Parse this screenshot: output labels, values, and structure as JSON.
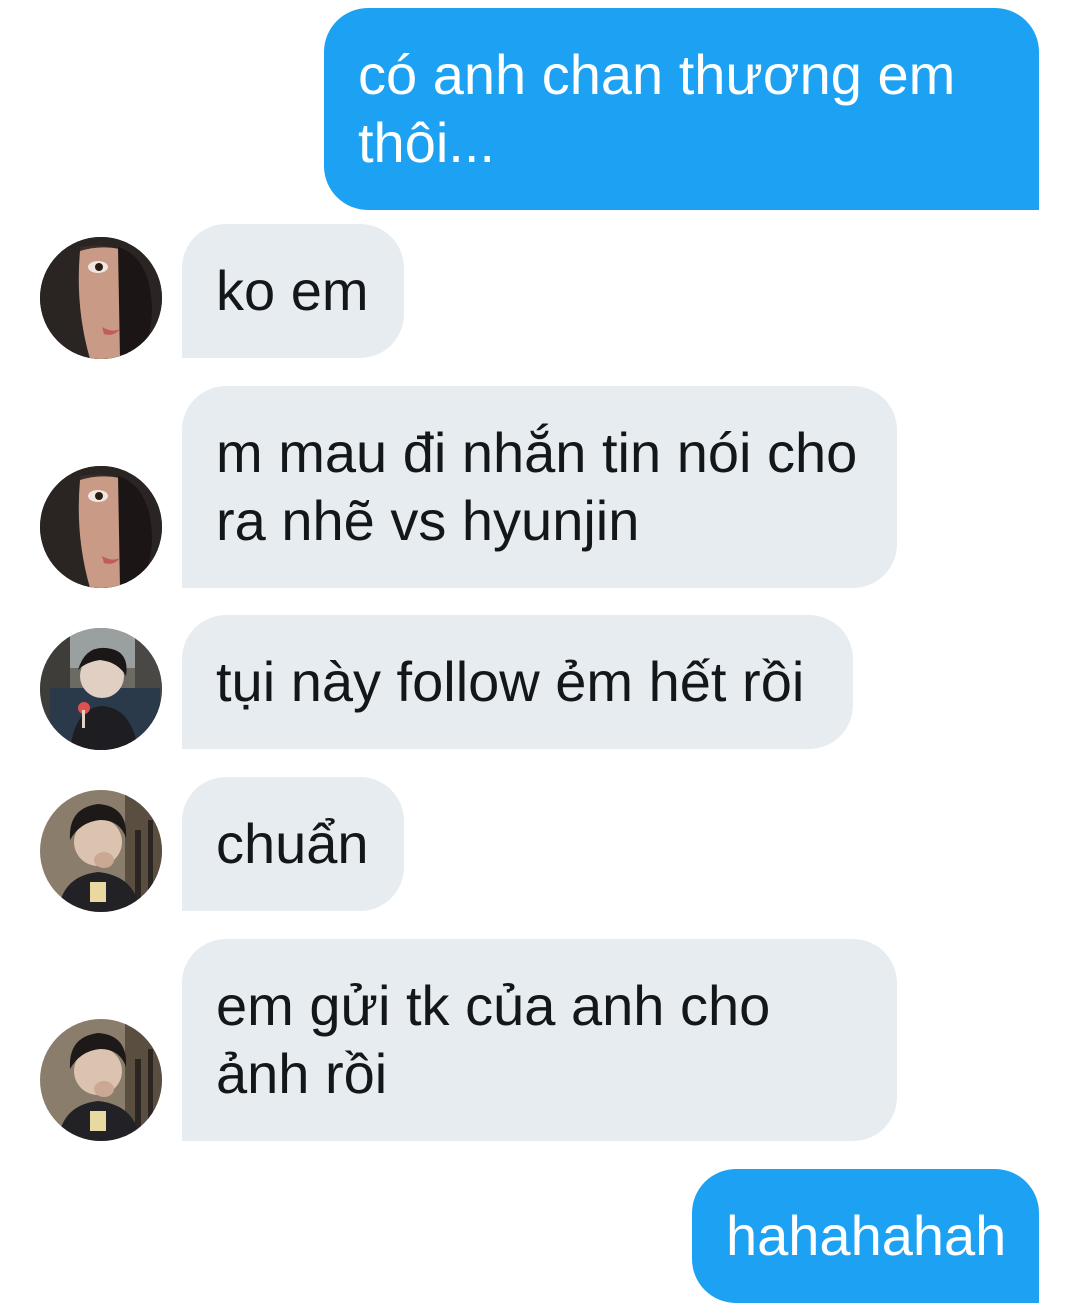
{
  "messages": [
    {
      "direction": "outgoing",
      "text": "có anh chan thương em thôi..."
    },
    {
      "direction": "incoming",
      "avatar": "hooded-user-avatar",
      "text": "ko em"
    },
    {
      "direction": "incoming",
      "avatar": "hooded-user-avatar",
      "text": "m mau đi nhắn tin nói cho ra nhẽ vs hyunjin"
    },
    {
      "direction": "incoming",
      "avatar": "bus-photo-user-avatar",
      "text": "tụi này follow ẻm hết rồi"
    },
    {
      "direction": "incoming",
      "avatar": "bearded-user-avatar",
      "text": "chuẩn"
    },
    {
      "direction": "incoming",
      "avatar": "bearded-user-avatar",
      "text": "em gửi tk của anh cho ảnh rồi"
    },
    {
      "direction": "outgoing",
      "text": "hahahahah"
    }
  ],
  "colors": {
    "outgoing_bubble": "#1da1f2",
    "incoming_bubble": "#e6ecf0",
    "incoming_text": "#14171a",
    "outgoing_text": "#ffffff"
  }
}
